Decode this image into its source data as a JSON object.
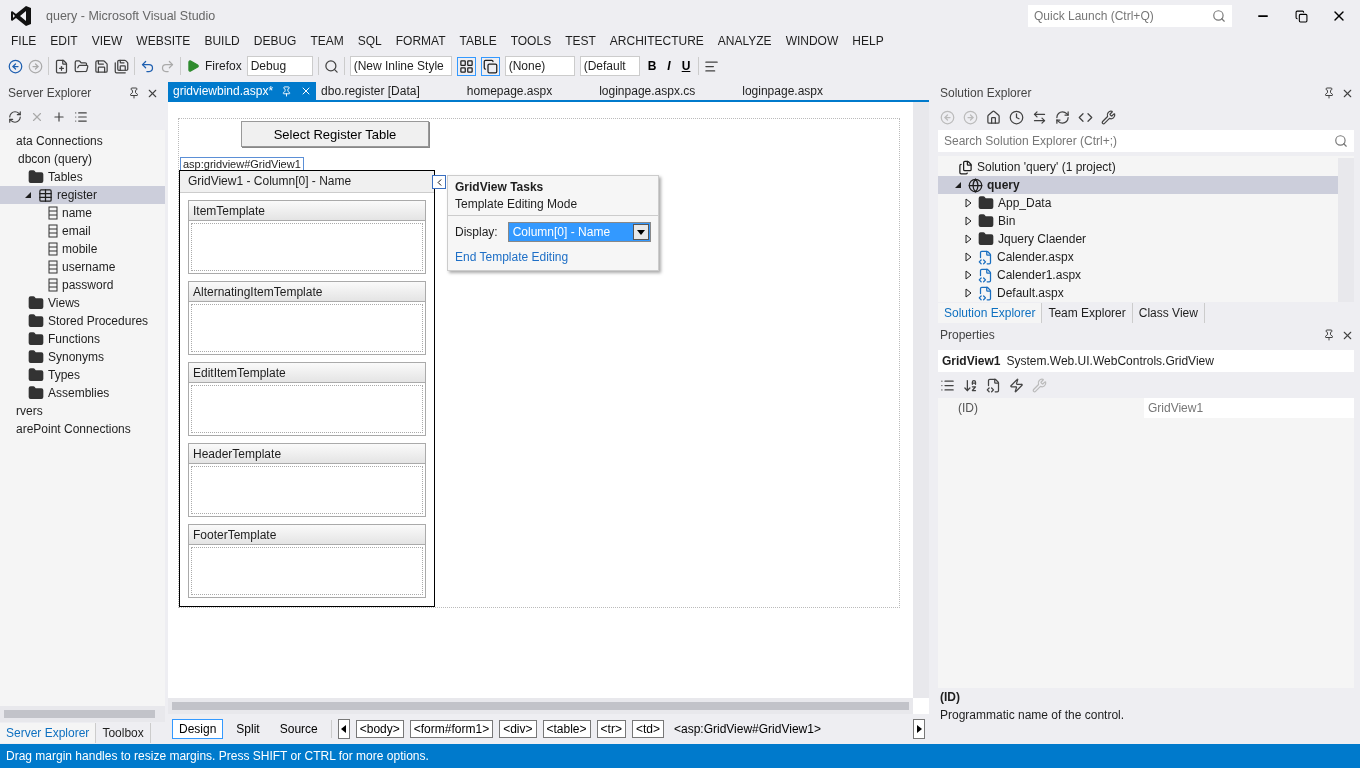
{
  "window": {
    "title": "query - Microsoft Visual Studio",
    "quick_launch_placeholder": "Quick Launch (Ctrl+Q)"
  },
  "menu": [
    "FILE",
    "EDIT",
    "VIEW",
    "WEBSITE",
    "BUILD",
    "DEBUG",
    "TEAM",
    "SQL",
    "FORMAT",
    "TABLE",
    "TOOLS",
    "TEST",
    "ARCHITECTURE",
    "ANALYZE",
    "WINDOW",
    "HELP"
  ],
  "toolbar": {
    "browser": "Firefox",
    "configuration": "Debug",
    "style": "(New Inline Style",
    "target": "(None)",
    "font": "(Default",
    "format_buttons": [
      "B",
      "I",
      "U"
    ]
  },
  "server_explorer": {
    "title": "Server Explorer",
    "tree": [
      {
        "label": "ata Connections",
        "children": [
          {
            "label": "dbcon (query)",
            "children": [
              {
                "label": "Tables",
                "kind": "folder",
                "selected": false,
                "children": [
                  {
                    "label": "register",
                    "kind": "table",
                    "expanded": true,
                    "selected": true,
                    "children": [
                      {
                        "label": "name",
                        "kind": "column",
                        "selected": false
                      },
                      {
                        "label": "email",
                        "kind": "column",
                        "selected": false
                      },
                      {
                        "label": "mobile",
                        "kind": "column",
                        "selected": false
                      },
                      {
                        "label": "username",
                        "kind": "column",
                        "selected": false
                      },
                      {
                        "label": "password",
                        "kind": "column",
                        "selected": false
                      }
                    ]
                  }
                ]
              },
              {
                "label": "Views",
                "kind": "folder",
                "selected": false
              },
              {
                "label": "Stored Procedures",
                "kind": "folder",
                "selected": false
              },
              {
                "label": "Functions",
                "kind": "folder",
                "selected": false
              },
              {
                "label": "Synonyms",
                "kind": "folder",
                "selected": false
              },
              {
                "label": "Types",
                "kind": "folder",
                "selected": false
              },
              {
                "label": "Assemblies",
                "kind": "folder",
                "selected": false
              }
            ]
          }
        ]
      },
      {
        "label": "rvers"
      },
      {
        "label": "arePoint Connections"
      }
    ],
    "tabs": [
      {
        "label": "Server Explorer",
        "selected": true
      },
      {
        "label": "Toolbox",
        "selected": false
      }
    ]
  },
  "editor": {
    "tabs": [
      {
        "label": "gridviewbind.aspx*",
        "selected": true
      },
      {
        "label": "dbo.register [Data]",
        "selected": false
      },
      {
        "label": "homepage.aspx",
        "selected": false
      },
      {
        "label": "loginpage.aspx.cs",
        "selected": false
      },
      {
        "label": "loginpage.aspx",
        "selected": false
      }
    ],
    "designer": {
      "button": "Select Register Table",
      "control_tag": "asp:gridview#GridView1",
      "grid_title": "GridView1 - Column[0] - Name",
      "templates": [
        "ItemTemplate",
        "AlternatingItemTemplate",
        "EditItemTemplate",
        "HeaderTemplate",
        "FooterTemplate"
      ],
      "tasks": {
        "title": "GridView Tasks",
        "subtitle": "Template Editing Mode",
        "display_label": "Display:",
        "display_value": "Column[0] - Name",
        "link": "End Template Editing"
      }
    },
    "views": [
      {
        "label": "Design",
        "selected": true
      },
      {
        "label": "Split",
        "selected": false
      },
      {
        "label": "Source",
        "selected": false
      }
    ],
    "breadcrumbs": [
      "<body>",
      "<form#form1>",
      "<div>",
      "<table>",
      "<tr>",
      "<td>",
      "<asp:GridView#GridView1>"
    ]
  },
  "solution_explorer": {
    "title": "Solution Explorer",
    "search_placeholder": "Search Solution Explorer (Ctrl+;)",
    "tree": [
      {
        "label": "Solution 'query' (1 project)",
        "kind": "solution",
        "selected": false,
        "children": [
          {
            "label": "query",
            "kind": "website",
            "expanded": true,
            "selected": true,
            "children": [
              {
                "label": "App_Data",
                "kind": "folder",
                "expanded": false,
                "selected": false
              },
              {
                "label": "Bin",
                "kind": "folder",
                "expanded": false,
                "selected": false
              },
              {
                "label": "Jquery Claender",
                "kind": "folder",
                "expanded": false,
                "selected": false
              },
              {
                "label": "Calender.aspx",
                "kind": "page",
                "expanded": false,
                "selected": false
              },
              {
                "label": "Calender1.aspx",
                "kind": "page",
                "expanded": false,
                "selected": false
              },
              {
                "label": "Default.aspx",
                "kind": "page",
                "expanded": false,
                "selected": false
              }
            ]
          }
        ]
      }
    ],
    "tabs": [
      {
        "label": "Solution Explorer",
        "selected": true
      },
      {
        "label": "Team Explorer",
        "selected": false
      },
      {
        "label": "Class View",
        "selected": false
      }
    ]
  },
  "properties": {
    "title": "Properties",
    "object_name": "GridView1",
    "object_type": "System.Web.UI.WebControls.GridView",
    "rows": [
      {
        "name": "(ID)",
        "value": "GridView1"
      }
    ],
    "description_title": "(ID)",
    "description": "Programmatic name of the control."
  },
  "status_bar": "Drag margin handles to resize margins. Press SHIFT or CTRL for more options."
}
